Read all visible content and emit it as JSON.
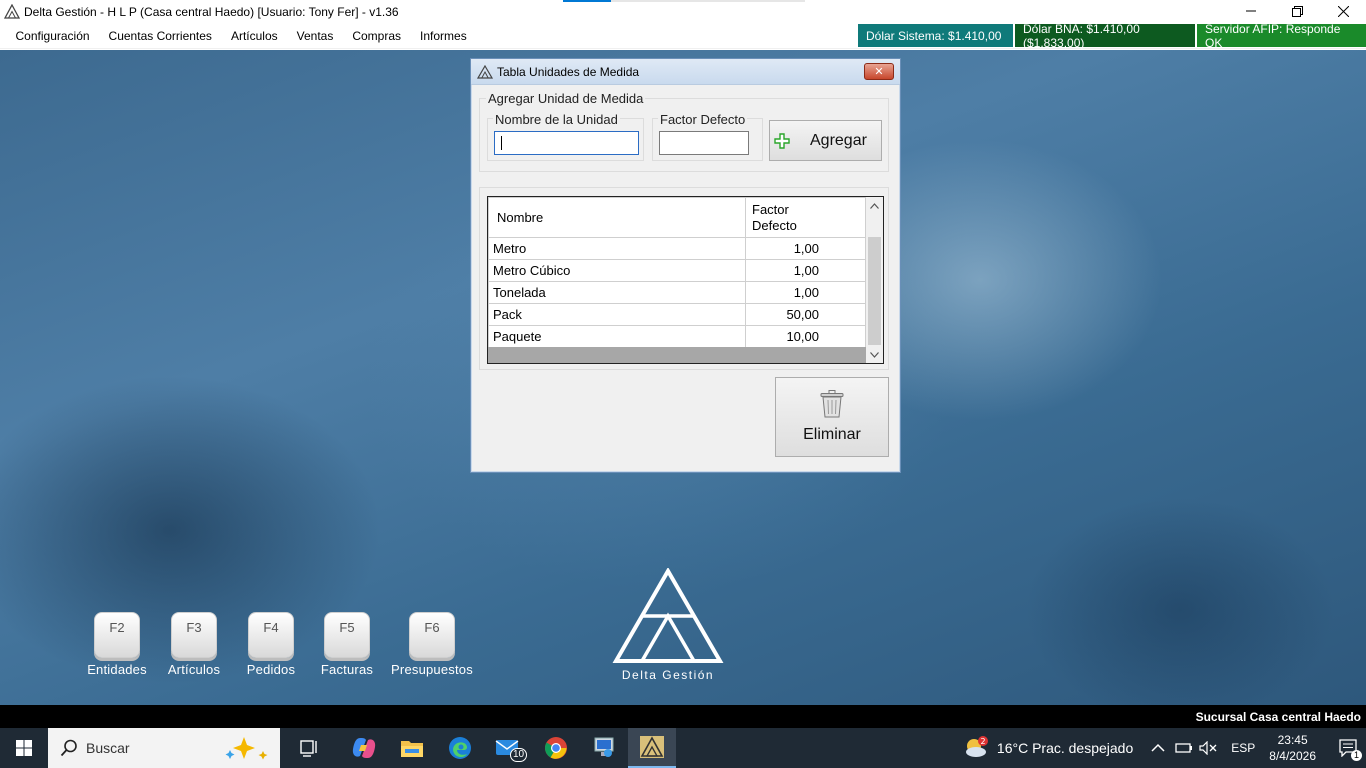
{
  "window": {
    "title": "Delta Gestión - H L P (Casa central Haedo) [Usuario: Tony Fer] - v1.36"
  },
  "menu": {
    "items": [
      "Configuración",
      "Cuentas Corrientes",
      "Artículos",
      "Ventas",
      "Compras",
      "Informes"
    ]
  },
  "badges": {
    "dolar_sistema": "Dólar Sistema: $1.410,00",
    "dolar_bna": "Dólar BNA: $1.410,00 ($1.833,00)",
    "servidor_afip": "Servidor AFIP:  Responde OK",
    "colors": {
      "dolar_sistema": "#0f7a7a",
      "dolar_bna": "#0d5a20",
      "servidor_afip": "#1a8a2a"
    }
  },
  "dialog": {
    "title": "Tabla Unidades de Medida",
    "close_label": "✕",
    "group_title": "Agregar Unidad de Medida",
    "name_label": "Nombre de la Unidad",
    "name_value": "",
    "factor_label": "Factor Defecto",
    "factor_value": "",
    "add_button": "Agregar",
    "delete_button": "Eliminar",
    "grid": {
      "columns": [
        "Nombre",
        "Factor Defecto"
      ],
      "rows": [
        {
          "nombre": "Metro",
          "factor": "1,00"
        },
        {
          "nombre": "Metro Cúbico",
          "factor": "1,00"
        },
        {
          "nombre": "Tonelada",
          "factor": "1,00"
        },
        {
          "nombre": "Pack",
          "factor": "50,00"
        },
        {
          "nombre": "Paquete",
          "factor": "10,00"
        }
      ]
    }
  },
  "shortcuts": [
    {
      "key": "F2",
      "label": "Entidades"
    },
    {
      "key": "F3",
      "label": "Artículos"
    },
    {
      "key": "F4",
      "label": "Pedidos"
    },
    {
      "key": "F5",
      "label": "Facturas"
    },
    {
      "key": "F6",
      "label": "Presupuestos"
    }
  ],
  "logo_text": "Delta Gestión",
  "statusbar": {
    "text": "Sucursal Casa central Haedo"
  },
  "taskbar": {
    "search_placeholder": "Buscar",
    "mail_badge": "10",
    "weather": "16°C  Prac. despejado",
    "weather_badge": "2",
    "language": "ESP",
    "time": "23:45",
    "date": "8/4/2026",
    "notification_count": "1"
  }
}
